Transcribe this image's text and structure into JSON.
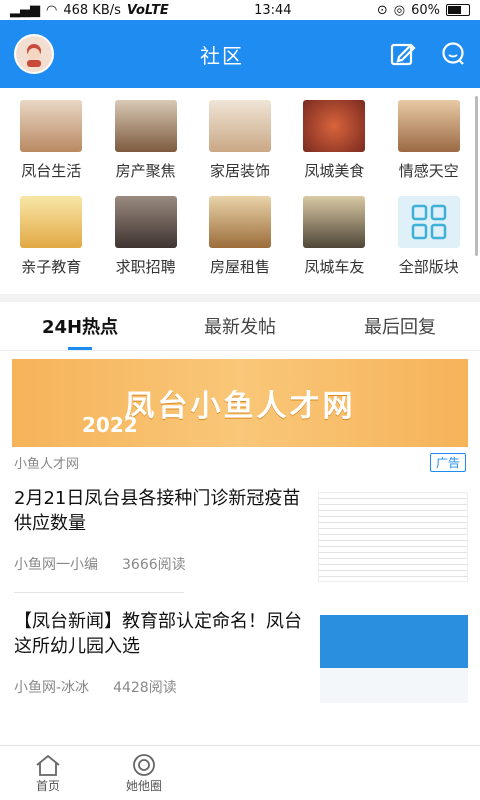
{
  "status": {
    "speed": "468 KB/s",
    "network": "VoLTE",
    "time": "13:44",
    "battery": "60%"
  },
  "header": {
    "title": "社区"
  },
  "categories": [
    {
      "label": "凤台生活",
      "color": "#c79a76"
    },
    {
      "label": "房产聚焦",
      "color": "#8f6a4e"
    },
    {
      "label": "家居装饰",
      "color": "#d7bea2"
    },
    {
      "label": "凤城美食",
      "color": "#b3473b"
    },
    {
      "label": "情感天空",
      "color": "#c58a5a"
    },
    {
      "label": "亲子教育",
      "color": "#e0b04a"
    },
    {
      "label": "求职招聘",
      "color": "#6f5e54"
    },
    {
      "label": "房屋租售",
      "color": "#b58c55"
    },
    {
      "label": "凤城车友",
      "color": "#6e6452"
    },
    {
      "label": "全部版块",
      "color": "#dceff8"
    }
  ],
  "tabs": [
    "24H热点",
    "最新发帖",
    "最后回复"
  ],
  "ad": {
    "headline": "凤台小鱼人才网",
    "year": "2022",
    "source": "小鱼人才网",
    "tag": "广告"
  },
  "news": [
    {
      "title": "2月21日凤台县各接种门诊新冠疫苗供应数量",
      "author": "小鱼网一小编",
      "reads": "3666阅读"
    },
    {
      "title": "【凤台新闻】教育部认定命名！凤台这所幼儿园入选",
      "author": "小鱼网-冰冰",
      "reads": "4428阅读"
    }
  ],
  "tabbar": {
    "home": "首页",
    "circle": "她他圈"
  }
}
